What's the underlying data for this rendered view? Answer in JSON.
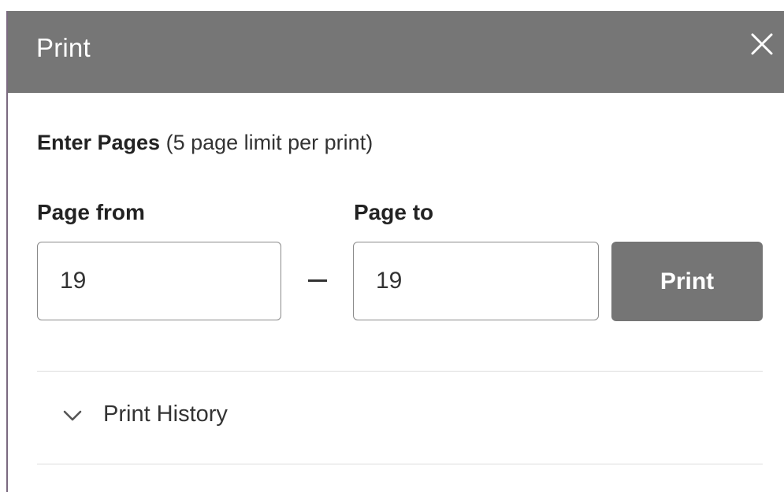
{
  "dialog": {
    "title": "Print",
    "close_icon": "close-icon"
  },
  "instructions": {
    "strong": "Enter Pages",
    "note": " (5 page limit per print)"
  },
  "range": {
    "from_label": "Page from",
    "from_value": "19",
    "separator": "–",
    "to_label": "Page to",
    "to_value": "19"
  },
  "actions": {
    "print_label": "Print"
  },
  "history": {
    "label": "Print History",
    "chevron_icon": "chevron-down-icon"
  },
  "colors": {
    "header_bg": "#767676",
    "button_bg": "#757575",
    "header_text": "#ffffff"
  }
}
